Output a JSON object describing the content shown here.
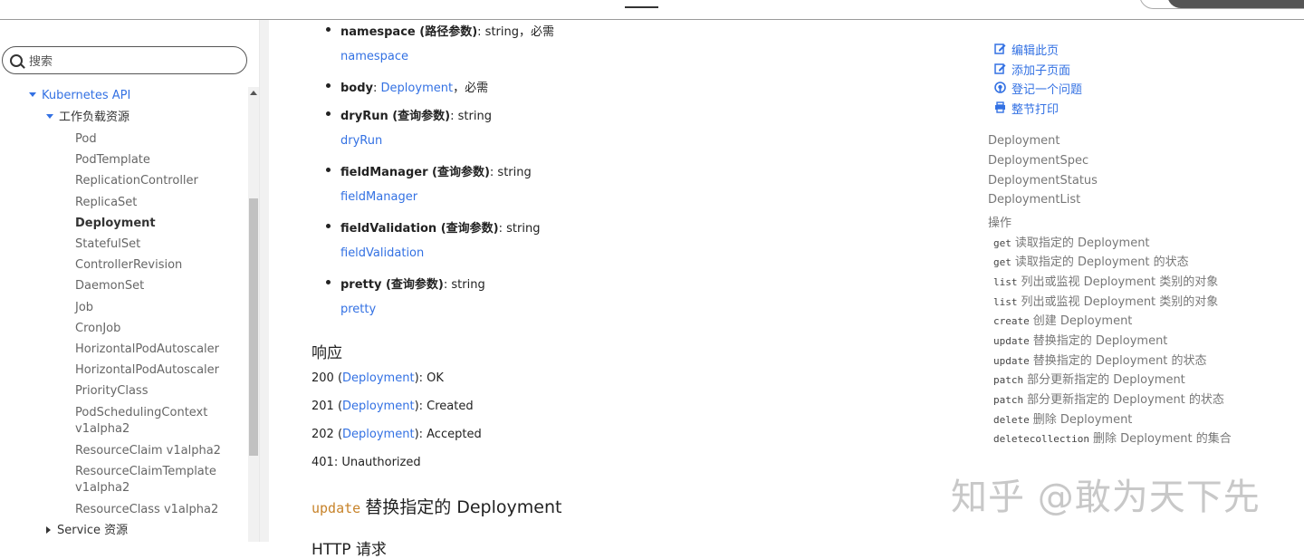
{
  "search": {
    "placeholder": "搜索"
  },
  "sidebar": {
    "section": "Kubernetes API",
    "group": "工作负载资源",
    "items": [
      "Pod",
      "PodTemplate",
      "ReplicationController",
      "ReplicaSet",
      "Deployment",
      "StatefulSet",
      "ControllerRevision",
      "DaemonSet",
      "Job",
      "CronJob",
      "HorizontalPodAutoscaler",
      "HorizontalPodAutoscaler",
      "PriorityClass"
    ],
    "wrapped_items": [
      {
        "line1": "PodSchedulingContext",
        "line2": "v1alpha2"
      },
      {
        "line1": "ResourceClaim v1alpha2",
        "line2": ""
      },
      {
        "line1": "ResourceClaimTemplate",
        "line2": "v1alpha2"
      },
      {
        "line1": "ResourceClass v1alpha2",
        "line2": ""
      }
    ],
    "next_group": "Service 资源",
    "active": "Deployment"
  },
  "params": [
    {
      "name": "namespace",
      "qual": " (路径参数)",
      "type": ": string，必需",
      "link": "namespace"
    },
    {
      "name": "body",
      "qual": "",
      "type_link": "Deployment",
      "type": "，必需",
      "link": ""
    },
    {
      "name": "dryRun",
      "qual": " (查询参数)",
      "type": ": string",
      "link": "dryRun"
    },
    {
      "name": "fieldManager",
      "qual": " (查询参数)",
      "type": ": string",
      "link": "fieldManager"
    },
    {
      "name": "fieldValidation",
      "qual": " (查询参数)",
      "type": ": string",
      "link": "fieldValidation"
    },
    {
      "name": "pretty",
      "qual": " (查询参数)",
      "type": ": string",
      "link": "pretty"
    }
  ],
  "response": {
    "heading": "响应",
    "rows": [
      {
        "code": "200 (",
        "link": "Deployment",
        "rest": "): OK"
      },
      {
        "code": "201 (",
        "link": "Deployment",
        "rest": "): Created"
      },
      {
        "code": "202 (",
        "link": "Deployment",
        "rest": "): Accepted"
      },
      {
        "code": "401: Unauthorized",
        "link": "",
        "rest": ""
      }
    ]
  },
  "operation": {
    "verb": "update",
    "title": "替换指定的 Deployment",
    "next_heading": "HTTP 请求"
  },
  "actions": [
    {
      "icon": "edit-icon",
      "label": "编辑此页"
    },
    {
      "icon": "add-page-icon",
      "label": "添加子页面"
    },
    {
      "icon": "github-icon",
      "label": "登记一个问题"
    },
    {
      "icon": "print-icon",
      "label": "整节打印"
    }
  ],
  "toc": [
    "Deployment",
    "DeploymentSpec",
    "DeploymentStatus",
    "DeploymentList",
    "操作"
  ],
  "toc_ops": [
    {
      "verb": "get",
      "text": "读取指定的 Deployment"
    },
    {
      "verb": "get",
      "text": "读取指定的 Deployment 的状态"
    },
    {
      "verb": "list",
      "text": "列出或监视 Deployment 类别的对象"
    },
    {
      "verb": "list",
      "text": "列出或监视 Deployment 类别的对象"
    },
    {
      "verb": "create",
      "text": "创建 Deployment"
    },
    {
      "verb": "update",
      "text": "替换指定的 Deployment"
    },
    {
      "verb": "update",
      "text": "替换指定的 Deployment 的状态"
    },
    {
      "verb": "patch",
      "text": "部分更新指定的 Deployment"
    },
    {
      "verb": "patch",
      "text": "部分更新指定的 Deployment 的状态"
    },
    {
      "verb": "delete",
      "text": "删除 Deployment"
    },
    {
      "verb": "deletecollection",
      "text": "删除 Deployment 的集合"
    }
  ],
  "watermark": "知乎 @敢为天下先",
  "colors": {
    "link": "#3371e3",
    "code_verb": "#c7832a",
    "muted": "#777777"
  }
}
